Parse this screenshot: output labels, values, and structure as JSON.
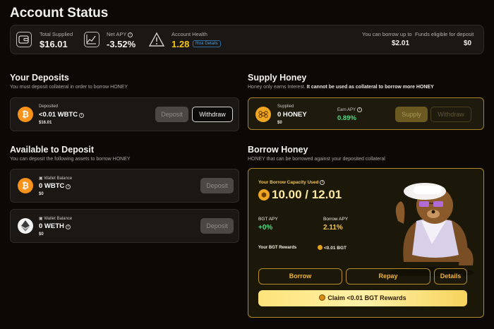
{
  "page_title": "Account Status",
  "account": {
    "total_supplied_label": "Total Supplied",
    "total_supplied_value": "$16.01",
    "net_apy_label": "Net APY",
    "net_apy_value": "-3.52%",
    "health_label": "Account Health",
    "health_value": "1.28",
    "risk_details_label": "Risk Details",
    "borrow_up_to_label": "You can borrow up to",
    "borrow_up_to_value": "$2.01",
    "funds_eligible_label": "Funds eligible for deposit",
    "funds_eligible_value": "$0",
    "colors": {
      "health": "#f5c518",
      "risk_link": "#4a9bdc"
    }
  },
  "deposits": {
    "title": "Your Deposits",
    "subtitle": "You must deposit collateral in order to borrow HONEY",
    "item": {
      "label": "Deposited",
      "amount": "<0.01 WBTC",
      "usd": "$16.01",
      "deposit_label": "Deposit",
      "withdraw_label": "Withdraw"
    }
  },
  "available": {
    "title": "Available to Deposit",
    "subtitle": "You can deposit the following assets to borrow HONEY",
    "items": [
      {
        "label": "Wallet Balance",
        "amount": "0 WBTC",
        "usd": "$0",
        "button": "Deposit"
      },
      {
        "label": "Wallet Balance",
        "amount": "0 WETH",
        "usd": "$0",
        "button": "Deposit"
      }
    ]
  },
  "supply_honey": {
    "title": "Supply Honey",
    "subtitle_plain": "Honey only earns Interest. ",
    "subtitle_bold": "It cannot be used as collateral to borrow more HONEY",
    "supplied_label": "Supplied",
    "supplied_amount": "0 HONEY",
    "supplied_usd": "$0",
    "earn_apy_label": "Earn APY",
    "earn_apy_value": "0.89%",
    "supply_button": "Supply",
    "withdraw_button": "Withdraw"
  },
  "borrow_honey": {
    "title": "Borrow Honey",
    "subtitle": "HONEY that can be borrowed against your deposited collateral",
    "capacity_label": "Your Borrow Capacity Used",
    "capacity_value": "10.00 / 12.01",
    "bgt_apy_label": "BGT APY",
    "bgt_apy_value": "+0%",
    "borrow_apy_label": "Borrow APY",
    "borrow_apy_value": "2.11%",
    "rewards_label": "Your BGT Rewards",
    "rewards_value": "<0.01 BGT",
    "borrow_button": "Borrow",
    "repay_button": "Repay",
    "details_button": "Details",
    "claim_button": "Claim <0.01 BGT Rewards"
  },
  "icons": [
    "wallet-icon",
    "chart-line-icon",
    "warning-icon",
    "info-icon",
    "bitcoin-icon",
    "ethereum-icon",
    "honey-icon",
    "bgt-token-icon"
  ]
}
